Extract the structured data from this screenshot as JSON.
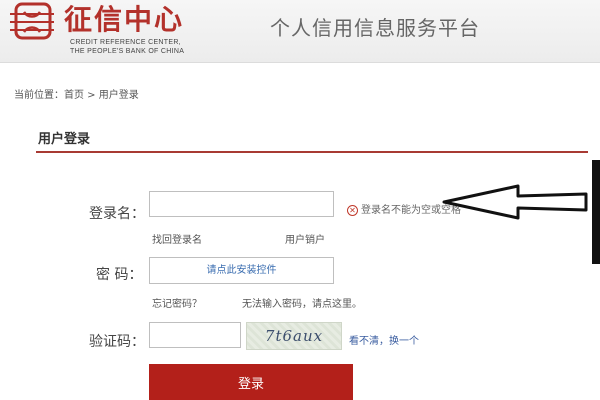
{
  "header": {
    "logo_name": "征信中心",
    "logo_en_line1": "CREDIT REFERENCE CENTER,",
    "logo_en_line2": "THE PEOPLE'S BANK OF CHINA",
    "site_title": "个人信用信息服务平台",
    "brand_color": "#b3312b"
  },
  "breadcrumb": "当前位置：首页 > 用户登录",
  "section": {
    "title": "用户登录"
  },
  "form": {
    "username_label": "登录名：",
    "username_value": "",
    "username_error": "登录名不能为空或空格",
    "recover_username_link": "找回登录名",
    "cancel_account_link": "用户销户",
    "password_label": "密  码：",
    "password_install_prompt": "请点此安装控件",
    "forgot_password_link": "忘记密码？",
    "cannot_input_link": "无法输入密码，请点这里。",
    "captcha_label": "验证码：",
    "captcha_value": "",
    "captcha_text": "7t6aux",
    "captcha_refresh_link": "看不清，换一个",
    "login_button": "登录"
  },
  "icons": {
    "error": "error-circle-x-icon",
    "annotation": "arrow-left-icon"
  },
  "colors": {
    "accent": "#b3201a",
    "rule": "#a83a33",
    "link": "#3a6db0"
  }
}
